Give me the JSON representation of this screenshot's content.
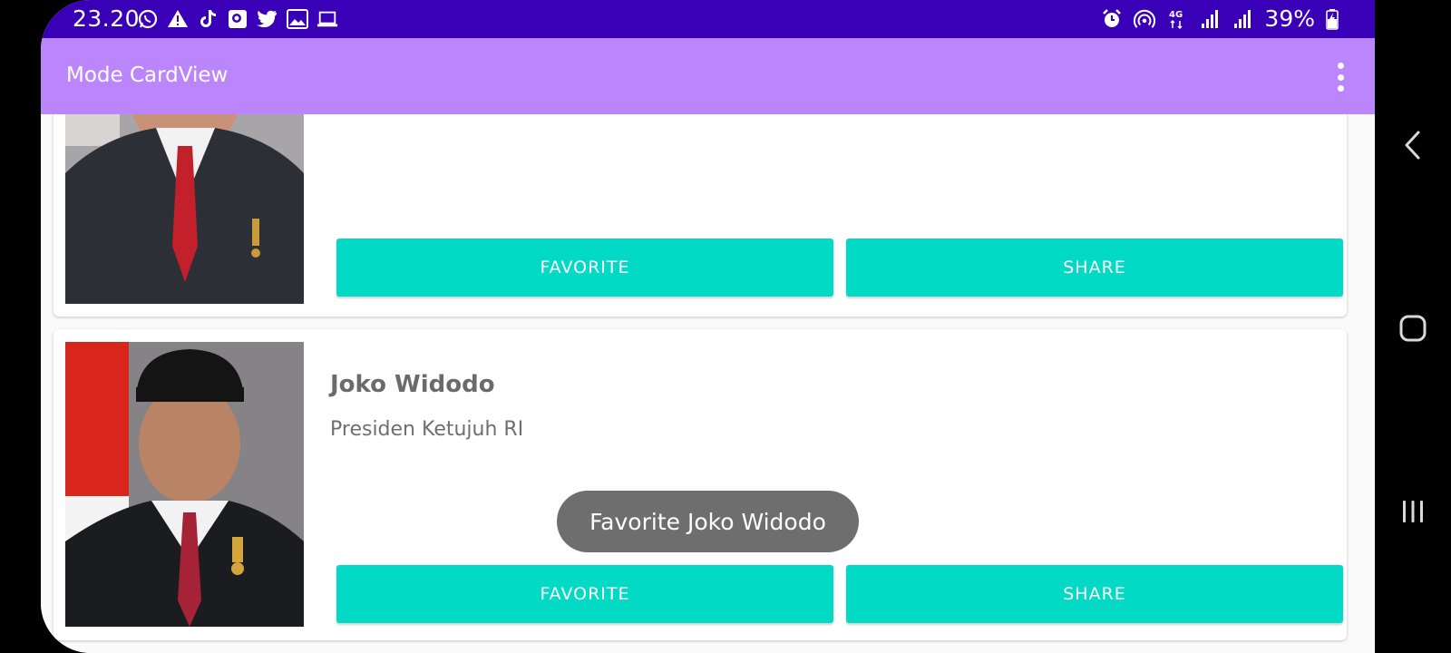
{
  "status_bar": {
    "time": "23.20",
    "battery": "39%",
    "left_icons": [
      "whatsapp-icon",
      "warning-icon",
      "tiktok-icon",
      "gallery-icon",
      "twitter-icon",
      "image-icon",
      "laptop-icon"
    ],
    "right_icons": [
      "alarm-icon",
      "hotspot-icon",
      "4g-icon",
      "signal-icon",
      "signal-icon",
      "battery-icon"
    ]
  },
  "app_bar": {
    "title": "Mode CardView",
    "menu_icon": "more-vert-icon",
    "background": "#bb86fc"
  },
  "cards": [
    {
      "name": "",
      "description": "",
      "favorite_label": "FAVORITE",
      "share_label": "SHARE"
    },
    {
      "name": "Joko Widodo",
      "description": "Presiden Ketujuh RI",
      "favorite_label": "FAVORITE",
      "share_label": "SHARE"
    }
  ],
  "toast": {
    "message": "Favorite Joko Widodo"
  },
  "colors": {
    "status_bar": "#3a00b8",
    "accent_button": "#03dac5"
  },
  "nav_bar": {
    "icons": [
      "back-icon",
      "home-icon",
      "recents-icon"
    ]
  }
}
